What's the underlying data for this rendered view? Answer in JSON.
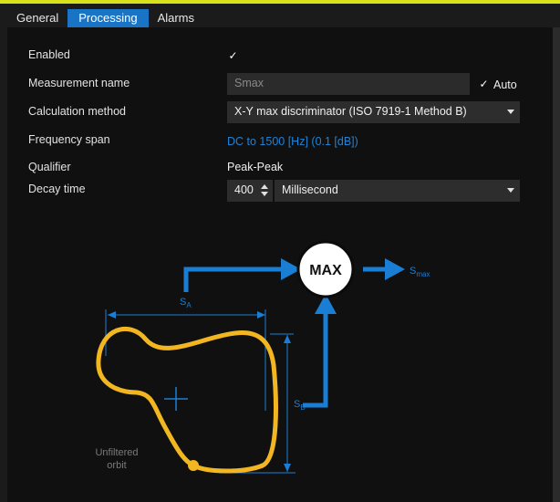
{
  "tabs": [
    {
      "label": "General",
      "active": false
    },
    {
      "label": "Processing",
      "active": true
    },
    {
      "label": "Alarms",
      "active": false
    }
  ],
  "form": {
    "enabled_label": "Enabled",
    "enabled_checked": true,
    "measurement_name_label": "Measurement name",
    "measurement_name_value": "Smax",
    "auto_label": "Auto",
    "auto_checked": true,
    "calculation_method_label": "Calculation method",
    "calculation_method_value": "X-Y max discriminator (ISO 7919-1 Method B)",
    "frequency_span_label": "Frequency span",
    "frequency_span_value": "DC to 1500 [Hz] (0.1 [dB])",
    "qualifier_label": "Qualifier",
    "qualifier_value": "Peak-Peak",
    "decay_time_label": "Decay time",
    "decay_time_value": "400",
    "decay_time_unit": "Millisecond"
  },
  "diagram": {
    "max_label": "MAX",
    "s_letter": "S",
    "sub_a": "A",
    "sub_b": "B",
    "sub_max": "max",
    "orbit_label_line1": "Unfiltered",
    "orbit_label_line2": "orbit"
  },
  "colors": {
    "accent": "#d7e21b",
    "tab_active": "#1a74c6",
    "diagram_blue": "#1a7fd4",
    "orbit": "#f2b620",
    "link": "#1f83d6"
  }
}
